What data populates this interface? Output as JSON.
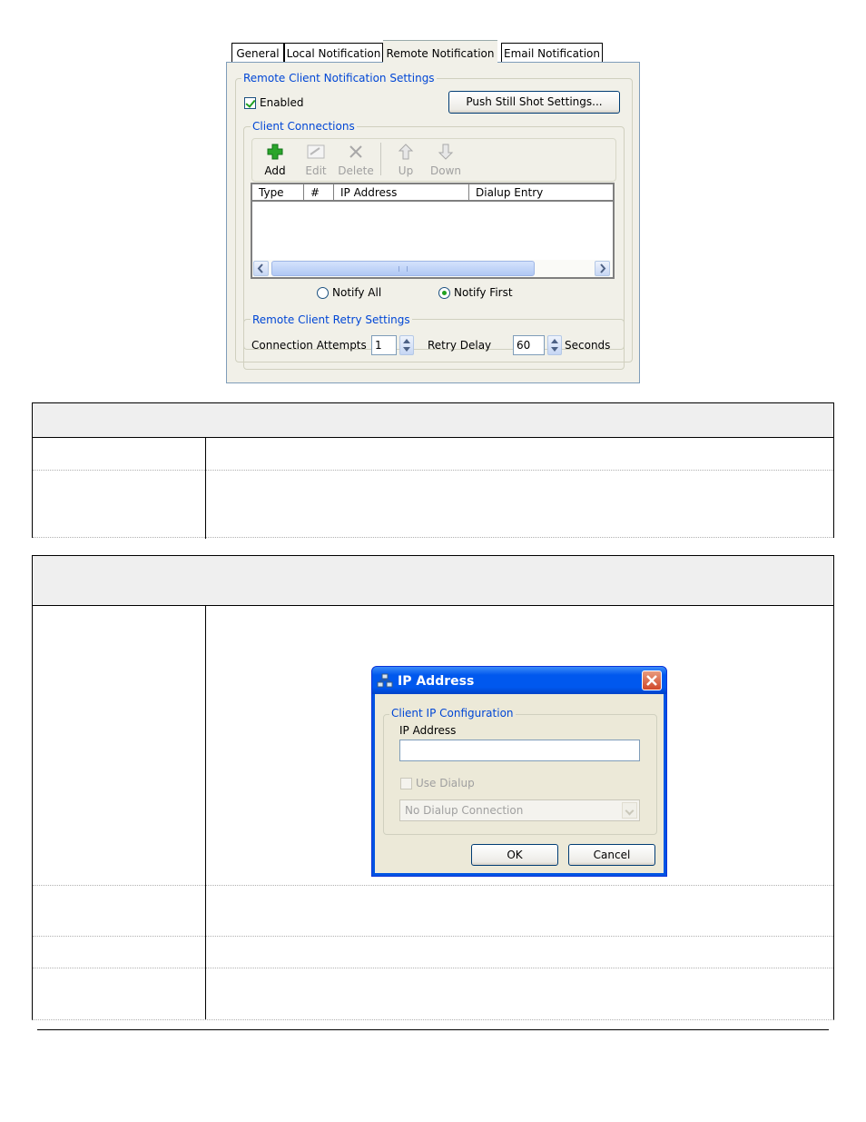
{
  "remote_dialog": {
    "tabs": [
      {
        "label": "General"
      },
      {
        "label": "Local Notification"
      },
      {
        "label": "Remote Notification"
      },
      {
        "label": "Email Notification"
      }
    ],
    "notification_group_label": "Remote Client Notification Settings",
    "enabled_label": "Enabled",
    "enabled_checked": true,
    "push_button_label": "Push Still Shot Settings...",
    "connections_group_label": "Client Connections",
    "toolbar": {
      "add": "Add",
      "edit": "Edit",
      "delete": "Delete",
      "up": "Up",
      "down": "Down"
    },
    "columns": [
      "Type",
      "#",
      "IP Address",
      "Dialup Entry"
    ],
    "notify_all_label": "Notify All",
    "notify_first_label": "Notify First",
    "notify_selected": "Notify First",
    "retry_group_label": "Remote Client Retry Settings",
    "connection_attempts_label": "Connection Attempts",
    "connection_attempts_value": "1",
    "retry_delay_label": "Retry Delay",
    "retry_delay_value": "60",
    "seconds_label": "Seconds"
  },
  "ip_dialog": {
    "title": "IP Address",
    "group_label": "Client IP Configuration",
    "ip_label": "IP Address",
    "ip_value": "",
    "use_dialup_label": "Use Dialup",
    "dialup_option": "No Dialup Connection",
    "ok_label": "OK",
    "cancel_label": "Cancel"
  },
  "colors": {
    "panel_bg": "#f1f0e8",
    "group_label": "#0046d5",
    "titlebar": "#0058ee",
    "check_green": "#21a121"
  }
}
